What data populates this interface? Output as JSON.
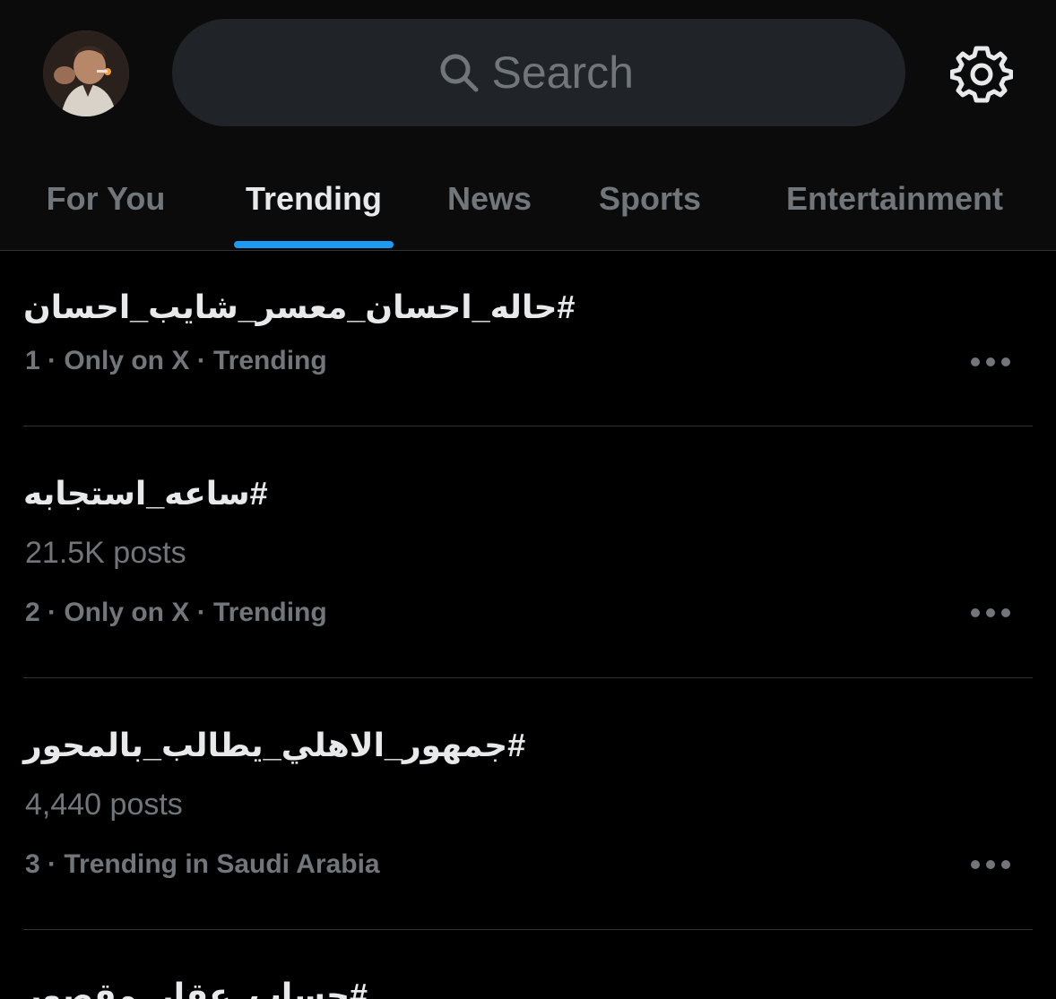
{
  "search": {
    "placeholder": "Search",
    "icon": "search-icon"
  },
  "header": {
    "avatar_icon": "avatar",
    "settings_icon": "gear-icon"
  },
  "tabs": [
    {
      "label": "For You",
      "active": false
    },
    {
      "label": "Trending",
      "active": true
    },
    {
      "label": "News",
      "active": false
    },
    {
      "label": "Sports",
      "active": false
    },
    {
      "label": "Entertainment",
      "active": false
    }
  ],
  "trends": [
    {
      "title": "#حاله_احسان_معسر_شايب_احسان",
      "posts": "",
      "meta": "1 · Only on X · Trending"
    },
    {
      "title": "#ساعه_استجابه",
      "posts": "21.5K posts",
      "meta": "2 · Only on X · Trending"
    },
    {
      "title": "#جمهور_الاهلي_يطالب_بالمحور",
      "posts": "4,440 posts",
      "meta": "3 · Trending in Saudi Arabia"
    },
    {
      "title": "#حساب_عقار_مقصور",
      "posts": "",
      "meta": ""
    }
  ],
  "colors": {
    "accent": "#1d9bf0",
    "text_primary": "#e7e9ea",
    "text_secondary": "#71767b",
    "divider": "#2f3336",
    "search_bg": "#202327"
  }
}
